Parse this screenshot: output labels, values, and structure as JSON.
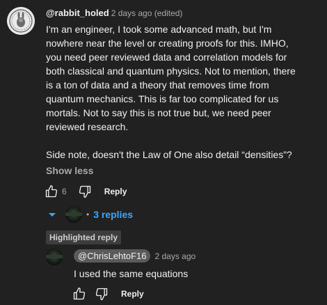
{
  "comment": {
    "author": "@rabbit_holed",
    "meta": "2 days ago (edited)",
    "paragraph1": "I'm an engineer, I took some advanced math, but I'm nowhere near the level or creating proofs for this. IMHO, you need peer reviewed data and correlation models for both classical and quantum physics. Not to mention, there is a ton of data and a theory that removes time from quantum mechanics. This is far too complicated for us mortals. Not to say this is not true but, we need peer reviewed research.",
    "paragraph2": "Side note, doesn't the Law of One also detail “densities”?",
    "show_less": "Show less",
    "like_count": "6",
    "reply_label": "Reply",
    "icons": {
      "like": "thumbs-up-icon",
      "dislike": "thumbs-down-icon",
      "avatar": "avatar-icon"
    }
  },
  "replies": {
    "dot": "•",
    "label": "3 replies",
    "accent": "#3ea6ff",
    "chevron_icon": "caret-down-icon"
  },
  "reply": {
    "badge": "Highlighted reply",
    "author": "@ChrisLehtoF16",
    "meta": "2 days ago",
    "text": "I used the same equations",
    "reply_label": "Reply"
  }
}
